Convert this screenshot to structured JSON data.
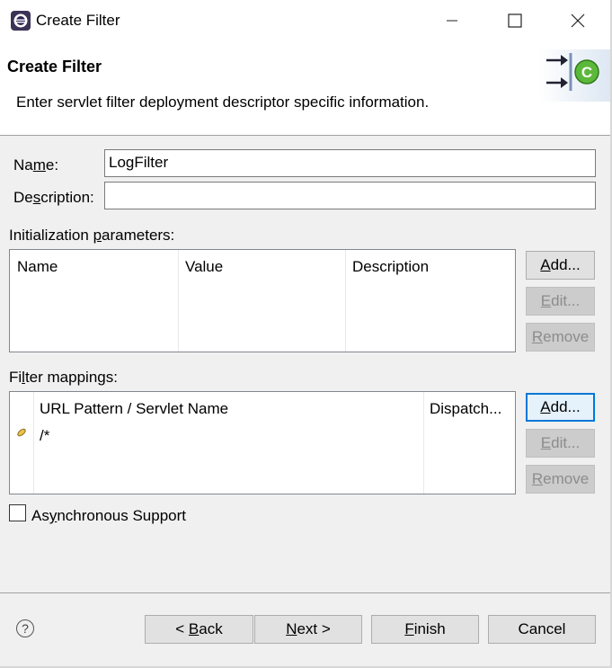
{
  "window": {
    "title": "Create Filter"
  },
  "banner": {
    "title": "Create Filter",
    "description": "Enter servlet filter deployment descriptor specific information."
  },
  "form": {
    "name_label_pre": "Na",
    "name_label_u": "m",
    "name_label_post": "e:",
    "name_value": "LogFilter",
    "desc_label_pre": "De",
    "desc_label_u": "s",
    "desc_label_post": "cription:",
    "desc_value": ""
  },
  "init_params": {
    "label_pre": "Initialization ",
    "label_u": "p",
    "label_post": "arameters:",
    "columns": [
      "Name",
      "Value",
      "Description"
    ]
  },
  "filter_mappings": {
    "label_pre": "Fi",
    "label_u": "l",
    "label_post": "ter mappings:",
    "columns": [
      "URL Pattern / Servlet Name",
      "Dispatch..."
    ],
    "rows": [
      {
        "pattern": "/*",
        "dispatcher": ""
      }
    ]
  },
  "side_buttons": {
    "add_u": "A",
    "add_post": "dd...",
    "edit_u": "E",
    "edit_post": "dit...",
    "remove_u": "R",
    "remove_post": "emove"
  },
  "async": {
    "label_pre": "As",
    "label_u": "y",
    "label_post": "nchronous Support",
    "checked": false
  },
  "footer": {
    "back_pre": "< ",
    "back_u": "B",
    "back_post": "ack",
    "next_u": "N",
    "next_post": "ext >",
    "finish_u": "F",
    "finish_post": "inish",
    "cancel": "Cancel",
    "help": "?"
  }
}
